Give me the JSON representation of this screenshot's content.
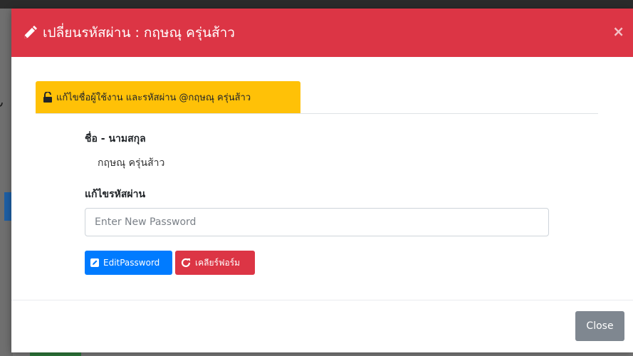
{
  "modal": {
    "title": "เปลี่ยนรหัสผ่าน : กฤษณุ ครุ่นส้าว",
    "close_symbol": "×",
    "header_color": "#dc3545",
    "header_icon": "pencil-icon"
  },
  "tab": {
    "label": "แก้ไขชื่อผู้ใช้งาน และรหัสผ่าน @กฤษณุ ครุ่นส้าว",
    "icon": "unlock-icon",
    "color": "#ffc107"
  },
  "form": {
    "name_label": "ชื่อ - นามสกุล",
    "name_value": "กฤษณุ ครุ่นส้าว",
    "password_label": "แก้ไขรหัสผ่าน",
    "password_placeholder": "Enter New Password",
    "password_value": ""
  },
  "buttons": {
    "edit_label": "EditPassword",
    "edit_icon": "edit-square-icon",
    "edit_color": "#007bff",
    "clear_label": "เคลียร์ฟอร์ม",
    "clear_icon": "refresh-icon",
    "clear_color": "#dc3545",
    "close_label": "Close",
    "close_color": "#7f8790"
  }
}
